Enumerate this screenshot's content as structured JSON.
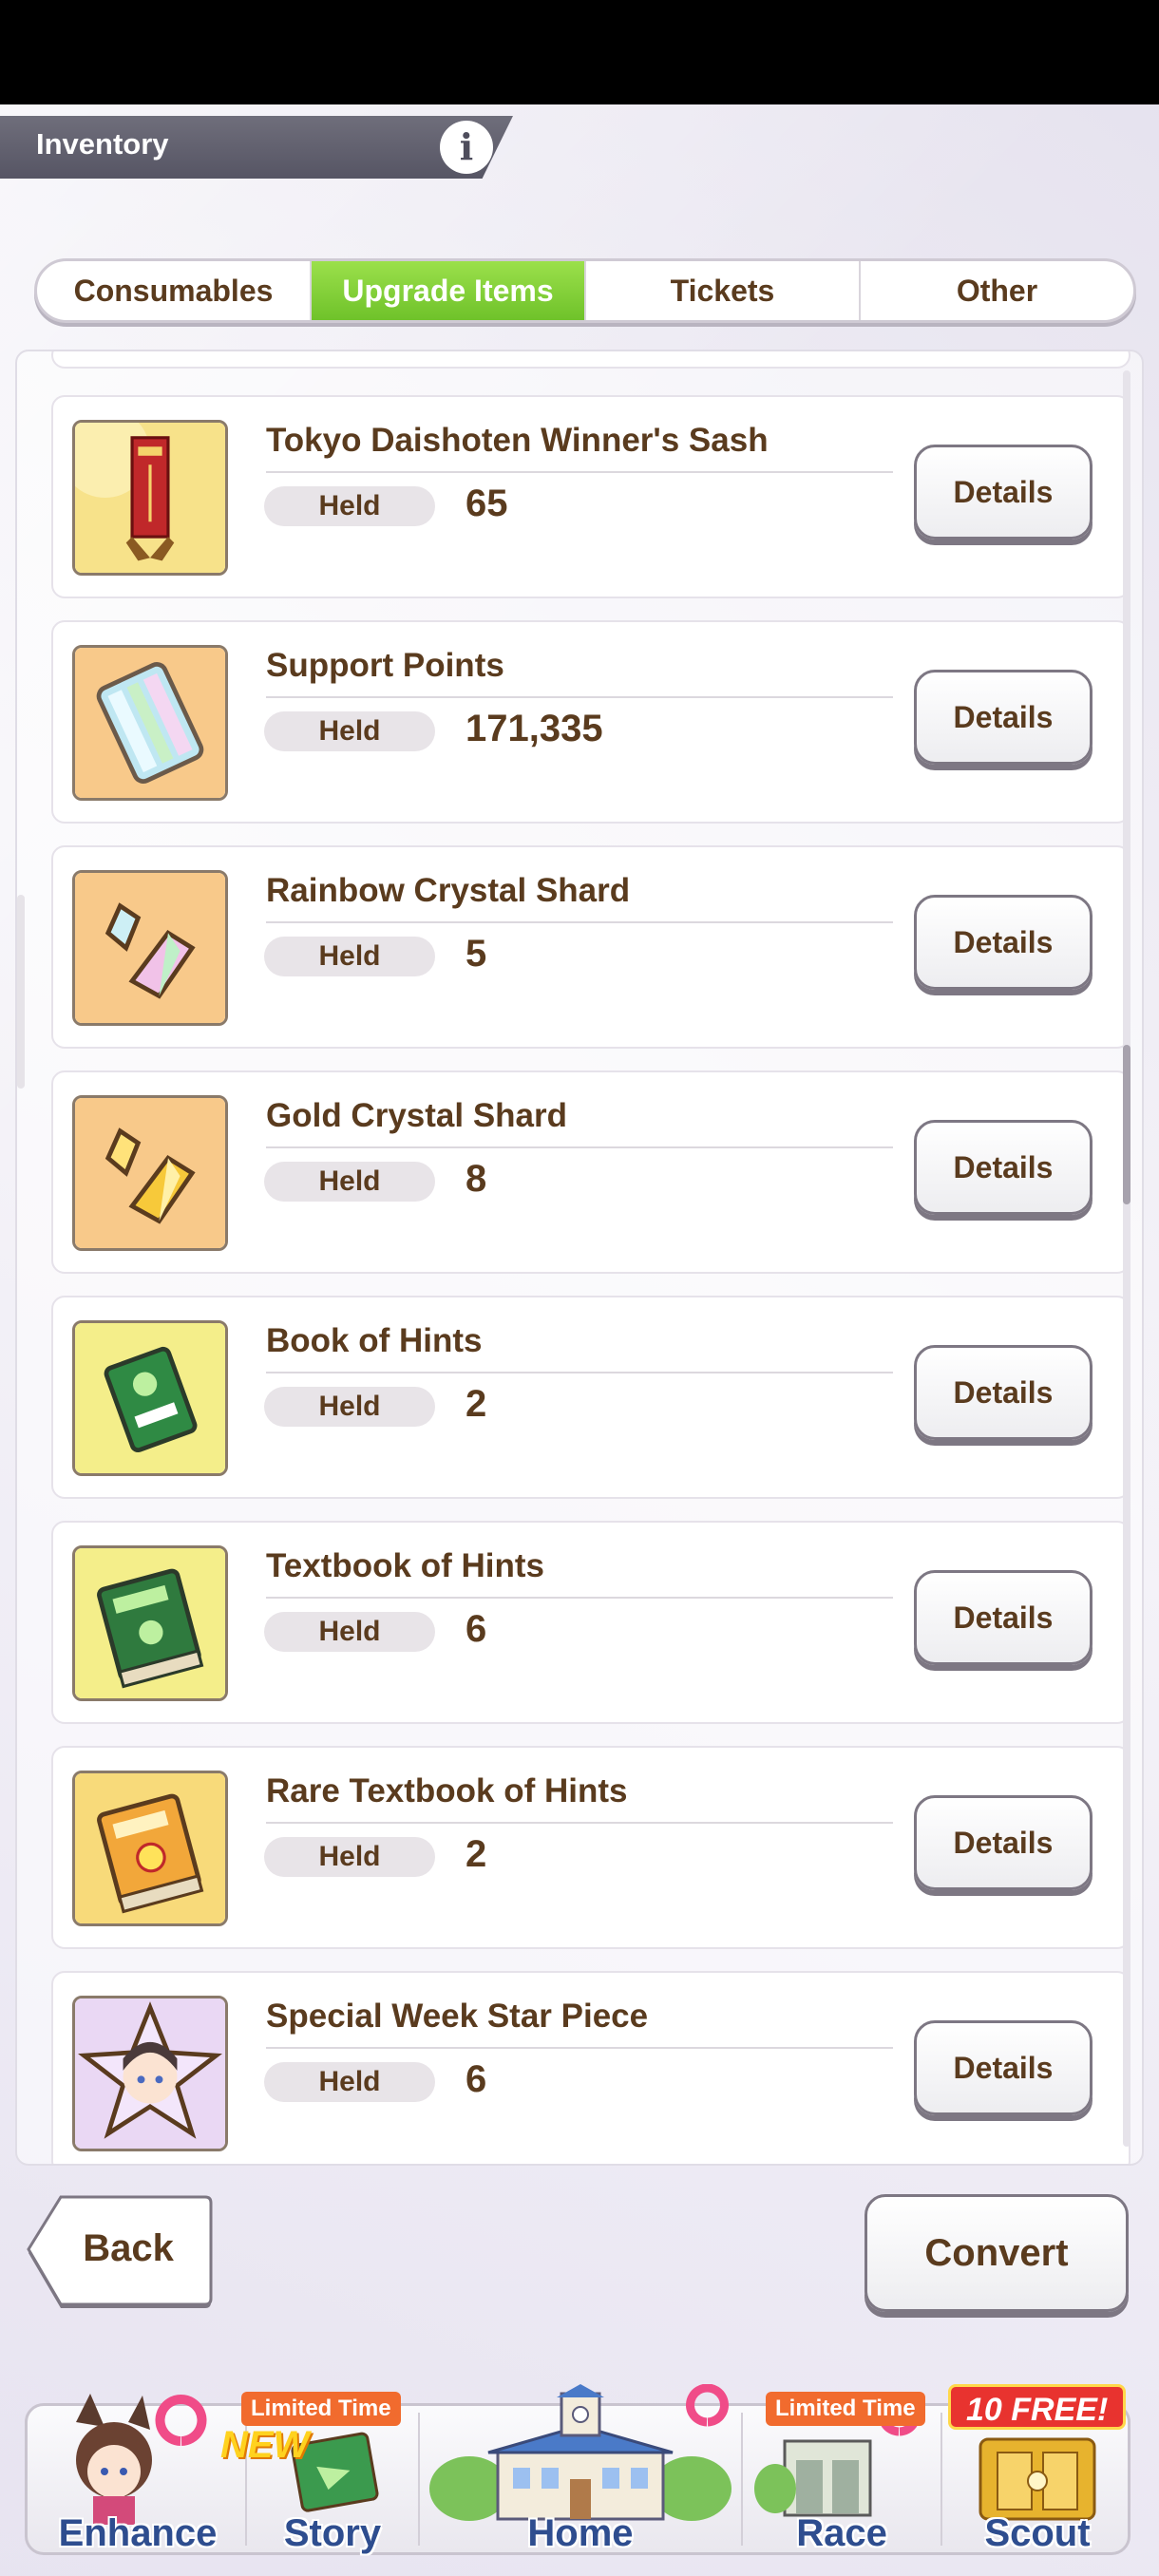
{
  "header": {
    "title": "Inventory",
    "info_glyph": "i"
  },
  "tabs": [
    {
      "label": "Consumables",
      "active": false
    },
    {
      "label": "Upgrade Items",
      "active": true
    },
    {
      "label": "Tickets",
      "active": false
    },
    {
      "label": "Other",
      "active": false
    }
  ],
  "held_label": "Held",
  "details_label": "Details",
  "items": [
    {
      "name": "Tokyo Daishoten Winner's Sash",
      "held": "65",
      "icon": "sash-icon"
    },
    {
      "name": "Support Points",
      "held": "171,335",
      "icon": "support-points-icon"
    },
    {
      "name": "Rainbow Crystal Shard",
      "held": "5",
      "icon": "rainbow-crystal-icon"
    },
    {
      "name": "Gold Crystal Shard",
      "held": "8",
      "icon": "gold-crystal-icon"
    },
    {
      "name": "Book of Hints",
      "held": "2",
      "icon": "book-of-hints-icon"
    },
    {
      "name": "Textbook of Hints",
      "held": "6",
      "icon": "textbook-of-hints-icon"
    },
    {
      "name": "Rare Textbook of Hints",
      "held": "2",
      "icon": "rare-textbook-icon"
    },
    {
      "name": "Special Week Star Piece",
      "held": "6",
      "icon": "star-piece-icon"
    }
  ],
  "buttons": {
    "back": "Back",
    "convert": "Convert"
  },
  "nav": {
    "enhance": "Enhance",
    "story": "Story",
    "home": "Home",
    "race": "Race",
    "scout": "Scout",
    "limited_time": "Limited Time",
    "new_badge": "NEW",
    "free_badge": "10 FREE!"
  },
  "colors": {
    "tab_active": "#7ccc32",
    "text_brown": "#5a3b1e",
    "nav_label": "#2e4d8f",
    "badge_orange": "#f16b2e"
  }
}
